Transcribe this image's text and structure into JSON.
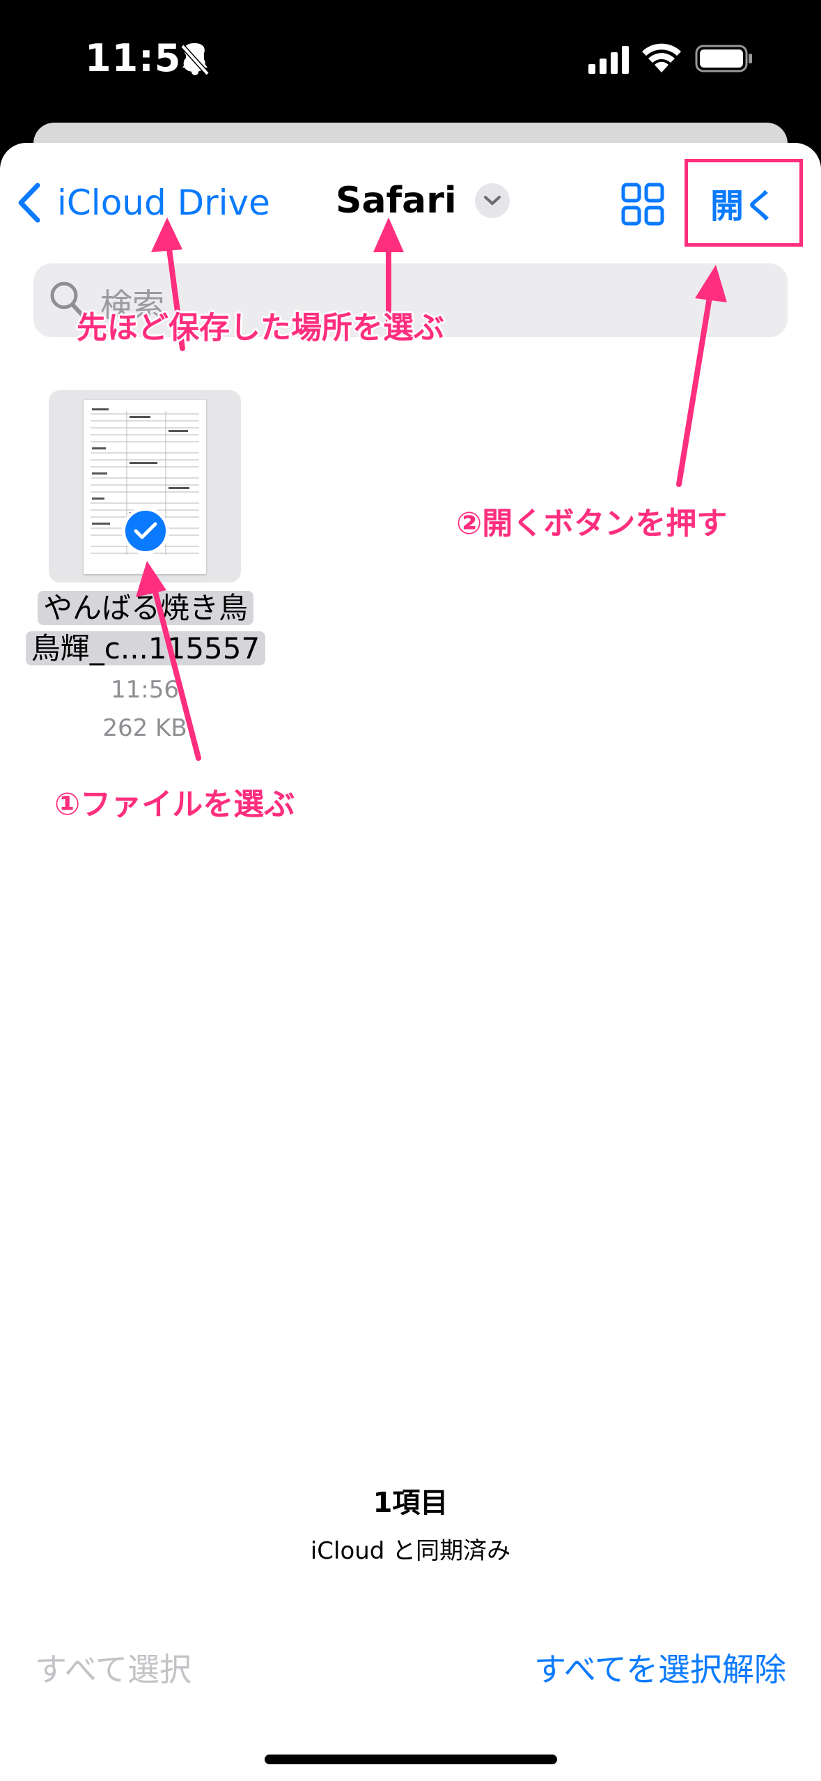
{
  "status_bar": {
    "time": "11:58"
  },
  "nav": {
    "back_label": "iCloud Drive",
    "title": "Safari",
    "open_label": "開く"
  },
  "search": {
    "placeholder": "検索"
  },
  "file": {
    "name_line1": "やんばる焼き鳥",
    "name_line2": "鳥輝_c...115557",
    "time": "11:56",
    "size": "262 KB",
    "selected": true
  },
  "annotations": {
    "choose_location": "先ほど保存した場所を選ぶ",
    "press_open": "②開くボタンを押す",
    "choose_file": "①ファイルを選ぶ"
  },
  "footer": {
    "item_count": "1項目",
    "sync_status": "iCloud と同期済み",
    "select_all": "すべて選択",
    "deselect_all": "すべてを選択解除"
  },
  "colors": {
    "accent": "#0a7aff",
    "annotation": "#ff2e7e"
  }
}
